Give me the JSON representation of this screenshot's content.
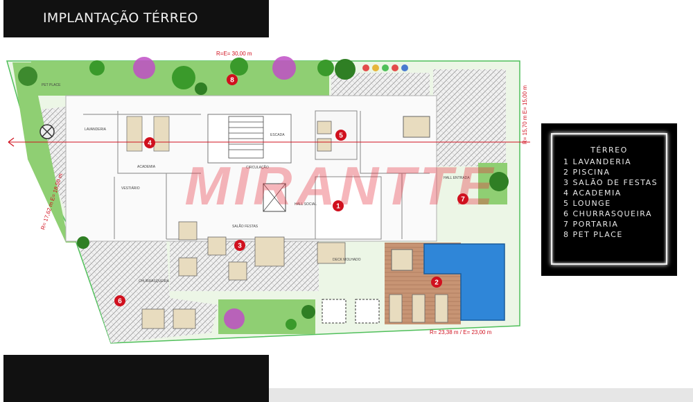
{
  "header": {
    "title": "IMPLANTAÇÃO TÉRREO"
  },
  "plan": {
    "watermark": "MIRANTTE",
    "dimensions": {
      "top": "R=E= 30,00 m",
      "bottom": "R= 23,38 m / E= 23,00 m",
      "right": "R= 15,70 m  E= 15,00 m",
      "left": "R= 17,62 m  E= 18,50 m"
    },
    "rooms": {
      "academia": "ACADEMIA",
      "salao_festas": "SALÃO FESTAS",
      "circulacao": "CIRCULAÇÃO",
      "hall_social": "HALL SOCIAL",
      "escada": "ESCADA",
      "deck_molhado": "DECK MOLHADO",
      "vestiario": "VESTIÁRIO",
      "hall_entrada": "HALL ENTRADA",
      "churrasqueira": "CHURRASQUEIRA",
      "pet_place": "PET PLACE",
      "lavanderia": "LAVANDERIA"
    },
    "markers": [
      "1",
      "2",
      "3",
      "4",
      "5",
      "6",
      "7",
      "8"
    ]
  },
  "legend": {
    "title": "TÉRREO",
    "items": [
      "1 LAVANDERIA",
      "2 PISCINA",
      "3 SALÃO DE FESTAS",
      "4 ACADEMIA",
      "5 LOUNGE",
      "6 CHURRASQUEIRA",
      "7 PORTARIA",
      "8 PET PLACE"
    ]
  },
  "colors": {
    "marker": "#d0101e",
    "grass": "#8fcf73",
    "pool": "#2f86d8",
    "deck": "#c08a6a",
    "watermark": "#e8313f",
    "paving": "#cfcfcf"
  }
}
